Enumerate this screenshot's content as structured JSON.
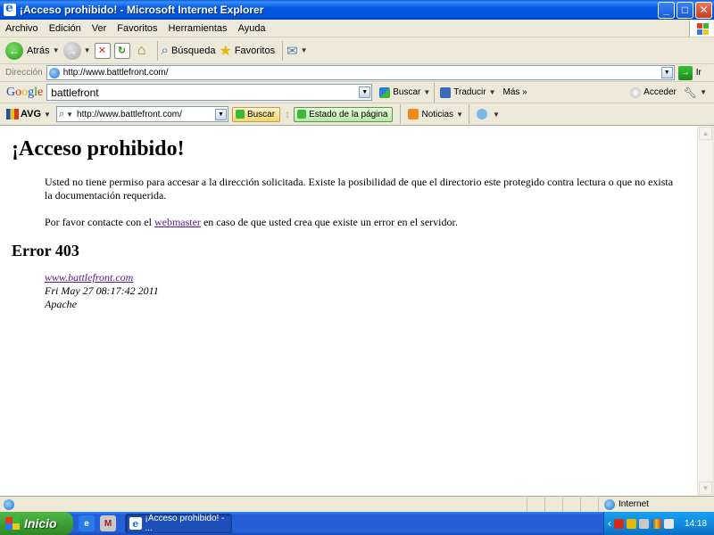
{
  "window": {
    "title": "¡Acceso prohibido! - Microsoft Internet Explorer",
    "minimize": "_",
    "maximize": "□",
    "close": "✕"
  },
  "menu": {
    "items": [
      "Archivo",
      "Edición",
      "Ver",
      "Favoritos",
      "Herramientas",
      "Ayuda"
    ]
  },
  "toolbar": {
    "back_label": "Atrás",
    "search_label": "Búsqueda",
    "favorites_label": "Favoritos"
  },
  "address": {
    "label": "Dirección",
    "value": "http://www.battlefront.com/",
    "go_label": "Ir"
  },
  "google": {
    "logo": "Google",
    "query": "battlefront",
    "search_label": "Buscar",
    "translate_label": "Traducir",
    "more_label": "Más »",
    "signin_label": "Acceder"
  },
  "avg": {
    "logo": "AVG",
    "url": "http://www.battlefront.com/",
    "search_label": "Buscar",
    "status_label": "Estado de la página",
    "news_label": "Noticias"
  },
  "page": {
    "heading": "¡Acceso prohibido!",
    "paragraph1": "Usted no tiene permiso para accesar a la dirección solicitada. Existe la posibilidad de que el directorio este protegido contra lectura o que no exista la documentación requerida.",
    "paragraph2_before": "Por favor contacte con el ",
    "paragraph2_link": "webmaster",
    "paragraph2_after": " en caso de que usted crea que existe un error en el servidor.",
    "error_heading": "Error 403",
    "footer_link": "www.battlefront.com",
    "footer_date": "Fri May 27 08:17:42 2011",
    "footer_server": "Apache"
  },
  "status": {
    "zone": "Internet"
  },
  "taskbar": {
    "start_label": "Inicio",
    "task_label": "¡Acceso prohibido! - ...",
    "clock": "14:18"
  }
}
